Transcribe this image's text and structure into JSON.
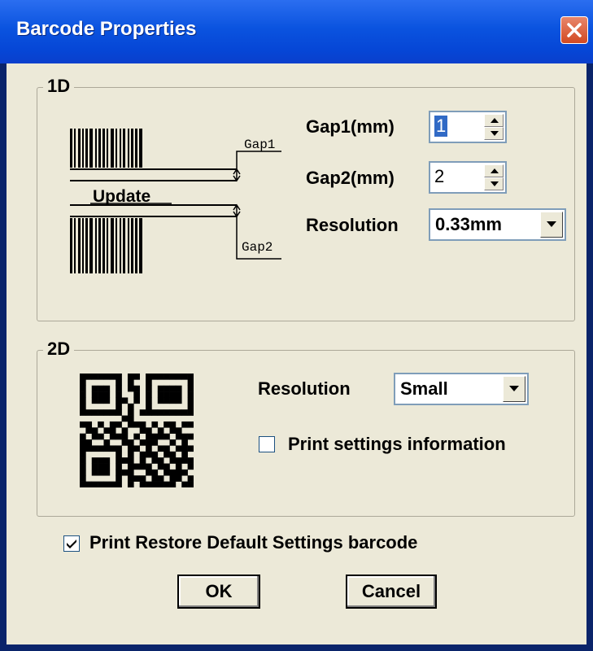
{
  "window": {
    "title": "Barcode Properties"
  },
  "group_1d": {
    "label": "1D",
    "diagram": {
      "gap1_label": "Gap1",
      "gap2_label": "Gap2",
      "update_label": "Update"
    },
    "gap1": {
      "label": "Gap1(mm)",
      "value": "1"
    },
    "gap2": {
      "label": "Gap2(mm)",
      "value": "2"
    },
    "resolution": {
      "label": "Resolution",
      "value": "0.33mm"
    }
  },
  "group_2d": {
    "label": "2D",
    "resolution": {
      "label": "Resolution",
      "value": "Small"
    },
    "print_settings": {
      "label": "Print settings information",
      "checked": false
    }
  },
  "print_restore": {
    "label": "Print Restore Default Settings barcode",
    "checked": true
  },
  "buttons": {
    "ok": "OK",
    "cancel": "Cancel"
  }
}
